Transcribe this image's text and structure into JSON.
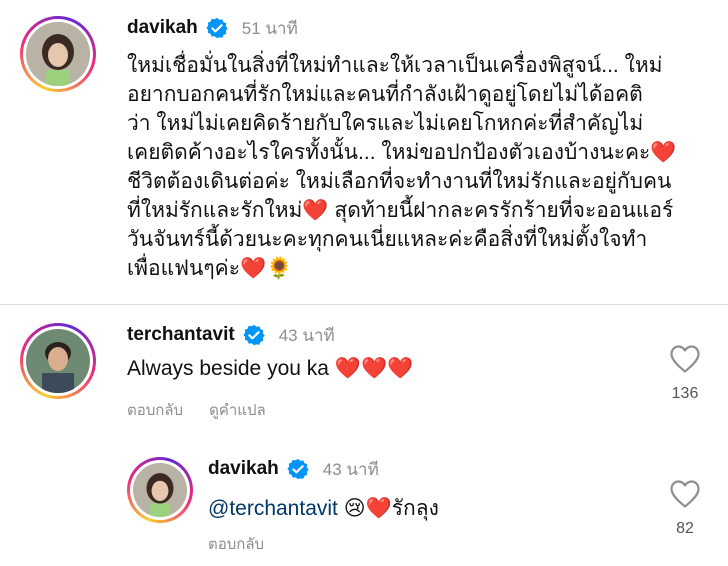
{
  "post": {
    "username": "davikah",
    "time": "51 นาที",
    "caption_lines": [
      "ใหม่เชื่อมั่นในสิ่งที่ใหม่ทำและให้เวลาเป็นเครื่องพิสูจน์... ใหม่",
      "อยากบอกคนที่รักใหม่และคนที่กำลังเฝ้าดูอยู่โดยไม่ได้อคติ",
      "ว่า ใหม่ไม่เคยคิดร้ายกับใครและไม่เคยโกหกค่ะที่สำคัญไม่",
      "เคยติดค้างอะไรใครทั้งนั้น... ใหม่ขอปกป้องตัวเองบ้างนะคะ",
      "ชีวิตต้องเดินต่อค่ะ ใหม่เลือกที่จะทำงานที่ใหม่รักและอยู่กับคน",
      "ที่ใหม่รักและรักใหม่",
      "สุดท้ายนี้ฝากละครรักร้ายที่จะออนแอร์",
      "วันจันทร์นี้ด้วยนะคะทุกคนเนี่ยแหละค่ะคือสิ่งที่ใหม่ตั้งใจทำ",
      "เพื่อแฟนๆค่ะ"
    ],
    "emoji_heart": "❤️",
    "emoji_sunflower": "🌻"
  },
  "comment1": {
    "username": "terchantavit",
    "time": "43 นาที",
    "text": "Always beside you ka",
    "hearts": "❤️❤️❤️",
    "reply_label": "ตอบกลับ",
    "translate_label": "ดูคำแปล",
    "likes": "136"
  },
  "comment2": {
    "username": "davikah",
    "time": "43 นาที",
    "mention": "@terchantavit",
    "emojis": "😢❤️",
    "text": "รักลุง",
    "reply_label": "ตอบกลับ",
    "likes": "82"
  }
}
